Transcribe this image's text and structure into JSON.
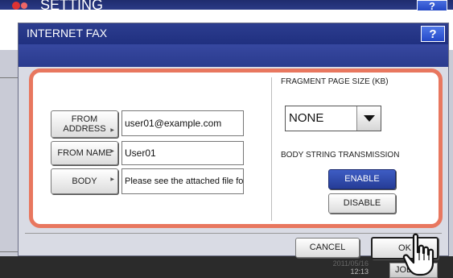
{
  "background": {
    "title": "SETTING",
    "help_label": "?",
    "clock_line1": "2011/05/16",
    "clock_line2": "12:13",
    "job_button": "JOB S"
  },
  "dialog": {
    "title": "INTERNET FAX",
    "help_label": "?"
  },
  "left_fields": [
    {
      "button_line1": "FROM",
      "button_line2": "ADDRESS",
      "value": "user01@example.com"
    },
    {
      "button_label": "FROM NAME",
      "value": "User01"
    },
    {
      "button_label": "BODY",
      "value": "Please see the attached file fo"
    }
  ],
  "fragment": {
    "label": "FRAGMENT PAGE SIZE (KB)",
    "selected": "NONE"
  },
  "body_string": {
    "label": "BODY STRING TRANSMISSION",
    "enable_label": "ENABLE",
    "disable_label": "DISABLE",
    "selected": "ENABLE"
  },
  "footer": {
    "cancel_label": "CANCEL",
    "ok_label": "OK"
  },
  "colors": {
    "accent_blue": "#2a3b8e",
    "highlight_border": "#e8775f"
  }
}
